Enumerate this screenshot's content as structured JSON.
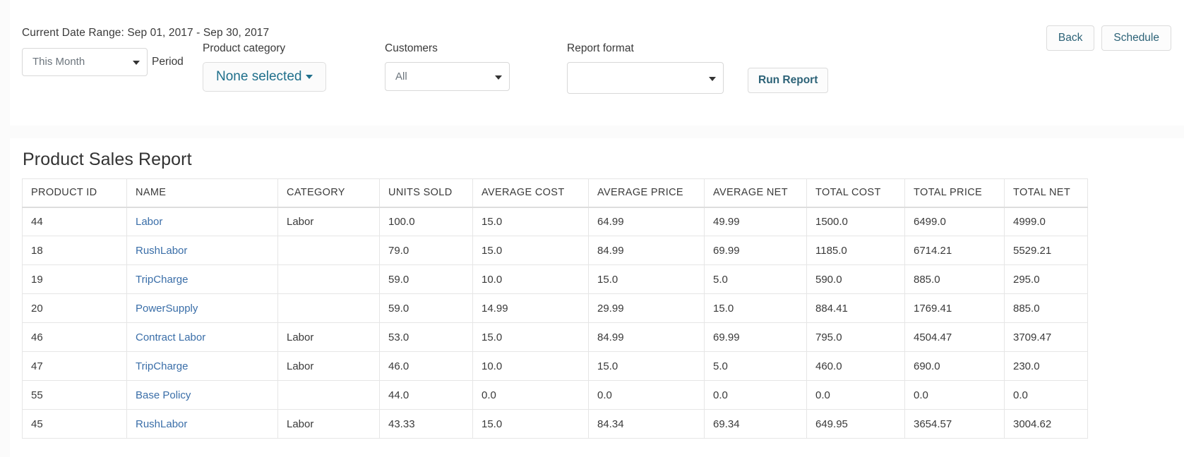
{
  "filters": {
    "date_range_text": "Current Date Range: Sep 01, 2017 - Sep 30, 2017",
    "period": {
      "label": "Period",
      "value": "This Month"
    },
    "product_category": {
      "label": "Product category",
      "value": "None selected"
    },
    "customers": {
      "label": "Customers",
      "value": "All"
    },
    "report_format": {
      "label": "Report format",
      "value": ""
    },
    "run_report_label": "Run Report",
    "back_label": "Back",
    "schedule_label": "Schedule"
  },
  "report": {
    "title": "Product Sales Report",
    "columns": [
      "PRODUCT ID",
      "NAME",
      "CATEGORY",
      "UNITS SOLD",
      "AVERAGE COST",
      "AVERAGE PRICE",
      "AVERAGE NET",
      "TOTAL COST",
      "TOTAL PRICE",
      "TOTAL NET"
    ],
    "rows": [
      {
        "product_id": "44",
        "name": "Labor",
        "category": "Labor",
        "units_sold": "100.0",
        "average_cost": "15.0",
        "average_price": "64.99",
        "average_net": "49.99",
        "total_cost": "1500.0",
        "total_price": "6499.0",
        "total_net": "4999.0"
      },
      {
        "product_id": "18",
        "name": "RushLabor",
        "category": "",
        "units_sold": "79.0",
        "average_cost": "15.0",
        "average_price": "84.99",
        "average_net": "69.99",
        "total_cost": "1185.0",
        "total_price": "6714.21",
        "total_net": "5529.21"
      },
      {
        "product_id": "19",
        "name": "TripCharge",
        "category": "",
        "units_sold": "59.0",
        "average_cost": "10.0",
        "average_price": "15.0",
        "average_net": "5.0",
        "total_cost": "590.0",
        "total_price": "885.0",
        "total_net": "295.0"
      },
      {
        "product_id": "20",
        "name": "PowerSupply",
        "category": "",
        "units_sold": "59.0",
        "average_cost": "14.99",
        "average_price": "29.99",
        "average_net": "15.0",
        "total_cost": "884.41",
        "total_price": "1769.41",
        "total_net": "885.0"
      },
      {
        "product_id": "46",
        "name": "Contract Labor",
        "category": "Labor",
        "units_sold": "53.0",
        "average_cost": "15.0",
        "average_price": "84.99",
        "average_net": "69.99",
        "total_cost": "795.0",
        "total_price": "4504.47",
        "total_net": "3709.47"
      },
      {
        "product_id": "47",
        "name": "TripCharge",
        "category": "Labor",
        "units_sold": "46.0",
        "average_cost": "10.0",
        "average_price": "15.0",
        "average_net": "5.0",
        "total_cost": "460.0",
        "total_price": "690.0",
        "total_net": "230.0"
      },
      {
        "product_id": "55",
        "name": "Base Policy",
        "category": "",
        "units_sold": "44.0",
        "average_cost": "0.0",
        "average_price": "0.0",
        "average_net": "0.0",
        "total_cost": "0.0",
        "total_price": "0.0",
        "total_net": "0.0"
      },
      {
        "product_id": "45",
        "name": "RushLabor",
        "category": "Labor",
        "units_sold": "43.33",
        "average_cost": "15.0",
        "average_price": "84.34",
        "average_net": "69.34",
        "total_cost": "649.95",
        "total_price": "3654.57",
        "total_net": "3004.62"
      }
    ]
  },
  "colors": {
    "link": "#3a6ea8",
    "accent": "#1f6f8b",
    "panel_bg": "#ffffff",
    "page_bg": "#fbfbfb",
    "border": "#e6e6e6"
  }
}
